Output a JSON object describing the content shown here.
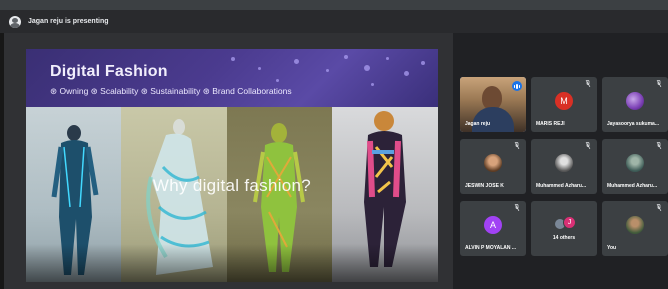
{
  "presenting_text": "Jagan reju is presenting",
  "slide": {
    "title": "Digital Fashion",
    "subtitle": "⊛ Owning ⊛ Scalability ⊛ Sustainability ⊛ Brand Collaborations",
    "overlay": "Why digital fashion?"
  },
  "participants": [
    {
      "name": "Jagan reju",
      "type": "video",
      "speaking": true
    },
    {
      "name": "MARIS REJI",
      "type": "initial",
      "initial": "M",
      "color": "#d93025",
      "muted": true
    },
    {
      "name": "Jayasoorya sukuma...",
      "type": "photo",
      "muted": true
    },
    {
      "name": "JESWIN JOSE K",
      "type": "photo",
      "muted": true
    },
    {
      "name": "Muhammed Azharu...",
      "type": "photo",
      "muted": true
    },
    {
      "name": "Muhammed Azharu...",
      "type": "photo",
      "muted": true
    },
    {
      "name": "ALVIN P MOYALAN ...",
      "type": "initial",
      "initial": "A",
      "color": "#a142f4",
      "muted": true
    },
    {
      "name": "14 others",
      "type": "others",
      "initial": "J"
    },
    {
      "name": "You",
      "type": "photo",
      "muted": true
    }
  ],
  "colors": {
    "speaking_border": "#8ab4f8",
    "background": "#202124",
    "tile": "#3c4043"
  }
}
